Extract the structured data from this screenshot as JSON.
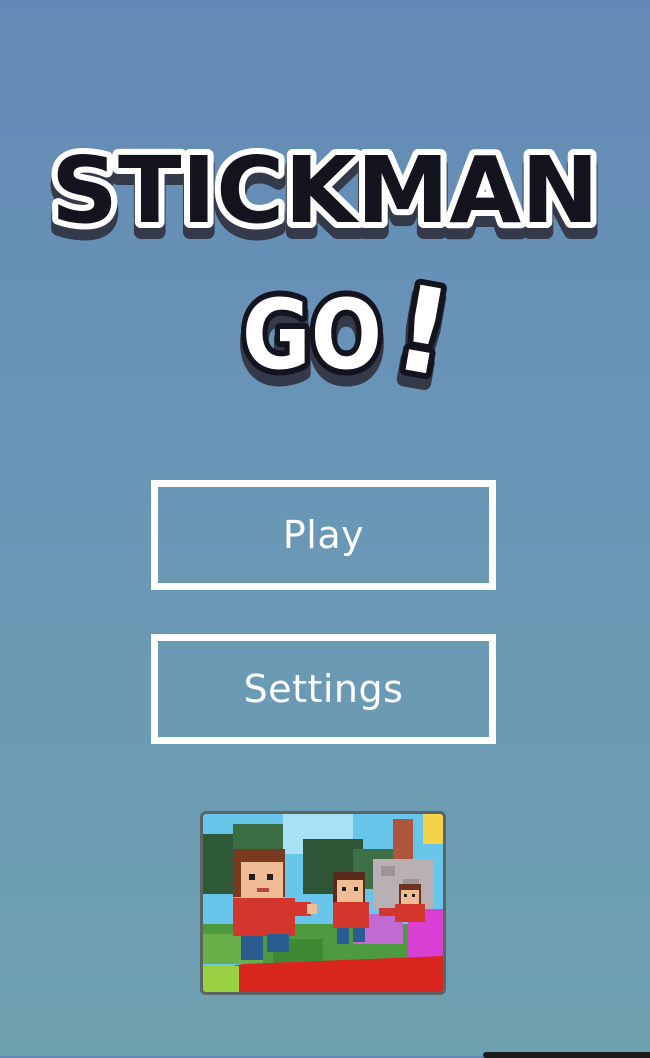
{
  "title": {
    "line1": "STICKMAN",
    "line2": "GO",
    "exclaim": "!"
  },
  "menu": {
    "play_label": "Play",
    "settings_label": "Settings"
  },
  "thumbnail": {
    "icon": "stickman-runners-ad-image"
  },
  "colors": {
    "background_top": "#6489b6",
    "background_bottom": "#6ea1b0",
    "logo_fill_dark": "#14141f",
    "logo_fill_light": "#ffffff",
    "button_border": "#ffffff"
  }
}
